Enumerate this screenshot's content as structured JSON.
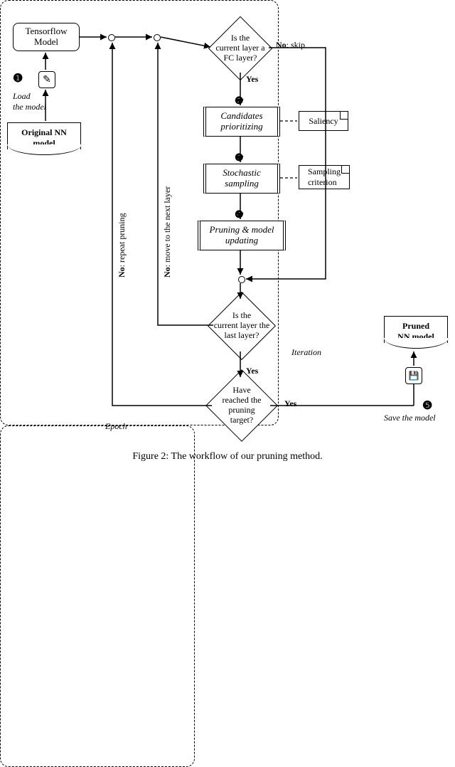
{
  "nodes": {
    "tensorflow_model": "Tensorflow\nModel",
    "original_nn": "Original NN\nmodel",
    "pruned_nn": "Pruned\nNN model",
    "q_fc_layer": "Is the\ncurrent layer a\nFC layer?",
    "candidates": "Candidates\nprioritizing",
    "stochastic": "Stochastic\nsampling",
    "pruning_update": "Pruning & model\nupdating",
    "saliency": "Saliency",
    "sampling_crit": "Sampling\ncriterion",
    "q_last_layer": "Is the\ncurrent layer the\nlast layer?",
    "q_target": "Have\nreached the\npruning\ntarget?"
  },
  "labels": {
    "load_model": "Load\nthe model",
    "save_model": "Save the model",
    "no_skip": "No: skip",
    "yes1": "Yes",
    "yes2": "Yes",
    "yes3": "Yes",
    "no_repeat": "No: repeat pruning",
    "no_next": "No: move to the next layer",
    "iteration": "Iteration",
    "epoch": "Epoch"
  },
  "steps": {
    "s1": "❶",
    "s2": "❷",
    "s3": "❸",
    "s4": "❹",
    "s5": "❺"
  },
  "icons": {
    "load": "✎",
    "save": "💾"
  },
  "caption": "Figure 2: The workflow of our pruning method."
}
